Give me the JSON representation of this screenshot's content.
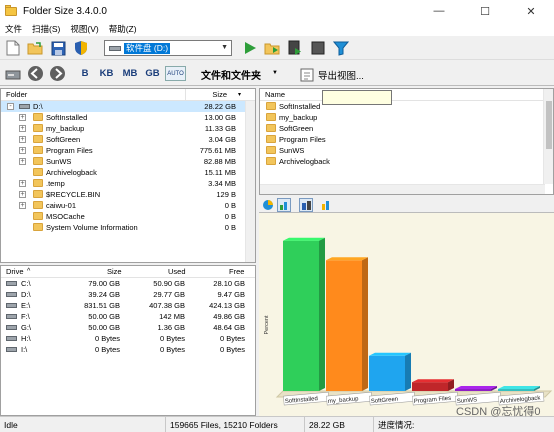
{
  "window": {
    "title": "Folder Size 3.4.0.0",
    "minimize": "—",
    "maximize": "☐",
    "close": "✕"
  },
  "menu": [
    "文件",
    "扫描(S)",
    "视图(V)",
    "帮助(Z)"
  ],
  "toolbar": {
    "drive_label": "软件盘 (D:)",
    "units": [
      "B",
      "KB",
      "MB",
      "GB",
      "AUTO"
    ],
    "filter_label": "文件和文件夹",
    "export_label": "导出视图..."
  },
  "folder_panel": {
    "col_folder": "Folder",
    "col_size": "Size",
    "rows": [
      {
        "name": "D:\\",
        "size": "28.22 GB",
        "root": true,
        "expander": "-"
      },
      {
        "name": "SoftInstalled",
        "size": "13.00 GB",
        "expander": "+"
      },
      {
        "name": "my_backup",
        "size": "11.33 GB",
        "expander": "+"
      },
      {
        "name": "SoftGreen",
        "size": "3.04 GB",
        "expander": "+"
      },
      {
        "name": "Program Files",
        "size": "775.61 MB",
        "expander": "+"
      },
      {
        "name": "SunWS",
        "size": "82.88 MB",
        "expander": "+"
      },
      {
        "name": "Archivelogback",
        "size": "15.11 MB",
        "expander": ""
      },
      {
        "name": ".temp",
        "size": "3.34 MB",
        "expander": "+"
      },
      {
        "name": "$RECYCLE.BIN",
        "size": "129 B",
        "expander": "+"
      },
      {
        "name": "caiwu-01",
        "size": "0 B",
        "expander": "+"
      },
      {
        "name": "MSOCache",
        "size": "0 B",
        "expander": ""
      },
      {
        "name": "System Volume Information",
        "size": "0 B",
        "expander": ""
      }
    ]
  },
  "drive_panel": {
    "col_drive": "Drive",
    "col_size": "Size",
    "col_used": "Used",
    "col_free": "Free",
    "rows": [
      {
        "drive": "C:\\",
        "size": "79.00 GB",
        "used": "50.90 GB",
        "free": "28.10 GB"
      },
      {
        "drive": "D:\\",
        "size": "39.24 GB",
        "used": "29.77 GB",
        "free": "9.47 GB"
      },
      {
        "drive": "E:\\",
        "size": "831.51 GB",
        "used": "407.38 GB",
        "free": "424.13 GB"
      },
      {
        "drive": "F:\\",
        "size": "50.00 GB",
        "used": "142 MB",
        "free": "49.86 GB"
      },
      {
        "drive": "G:\\",
        "size": "50.00 GB",
        "used": "1.36 GB",
        "free": "48.64 GB"
      },
      {
        "drive": "H:\\",
        "size": "0 Bytes",
        "used": "0 Bytes",
        "free": "0 Bytes"
      },
      {
        "drive": "I:\\",
        "size": "0 Bytes",
        "used": "0 Bytes",
        "free": "0 Bytes"
      }
    ]
  },
  "name_panel": {
    "col_name": "Name",
    "rows": [
      "SoftInstalled",
      "my_backup",
      "SoftGreen",
      "Program Files",
      "SunWS",
      "Archivelogback"
    ]
  },
  "chart_data": {
    "type": "bar",
    "ylabel": "Percent",
    "categories": [
      "SoftInstalled",
      "my_backup",
      "SoftGreen",
      "Program Files",
      "SunWS",
      "Archivelogback"
    ],
    "values": [
      46.1,
      40.1,
      10.8,
      2.7,
      0.3,
      0.05
    ],
    "ylim": [
      0,
      50
    ],
    "colors": [
      "#2fcf5a",
      "#ff8a1c",
      "#1fa5ef",
      "#c0262a",
      "#8e1fc5",
      "#35bfc0"
    ]
  },
  "statusbar": {
    "state": "Idle",
    "counts": "159665 Files, 15210 Folders",
    "total": "28.22 GB",
    "progress_label": "进度情况:",
    "watermark": "CSDN @忘忧得0"
  }
}
